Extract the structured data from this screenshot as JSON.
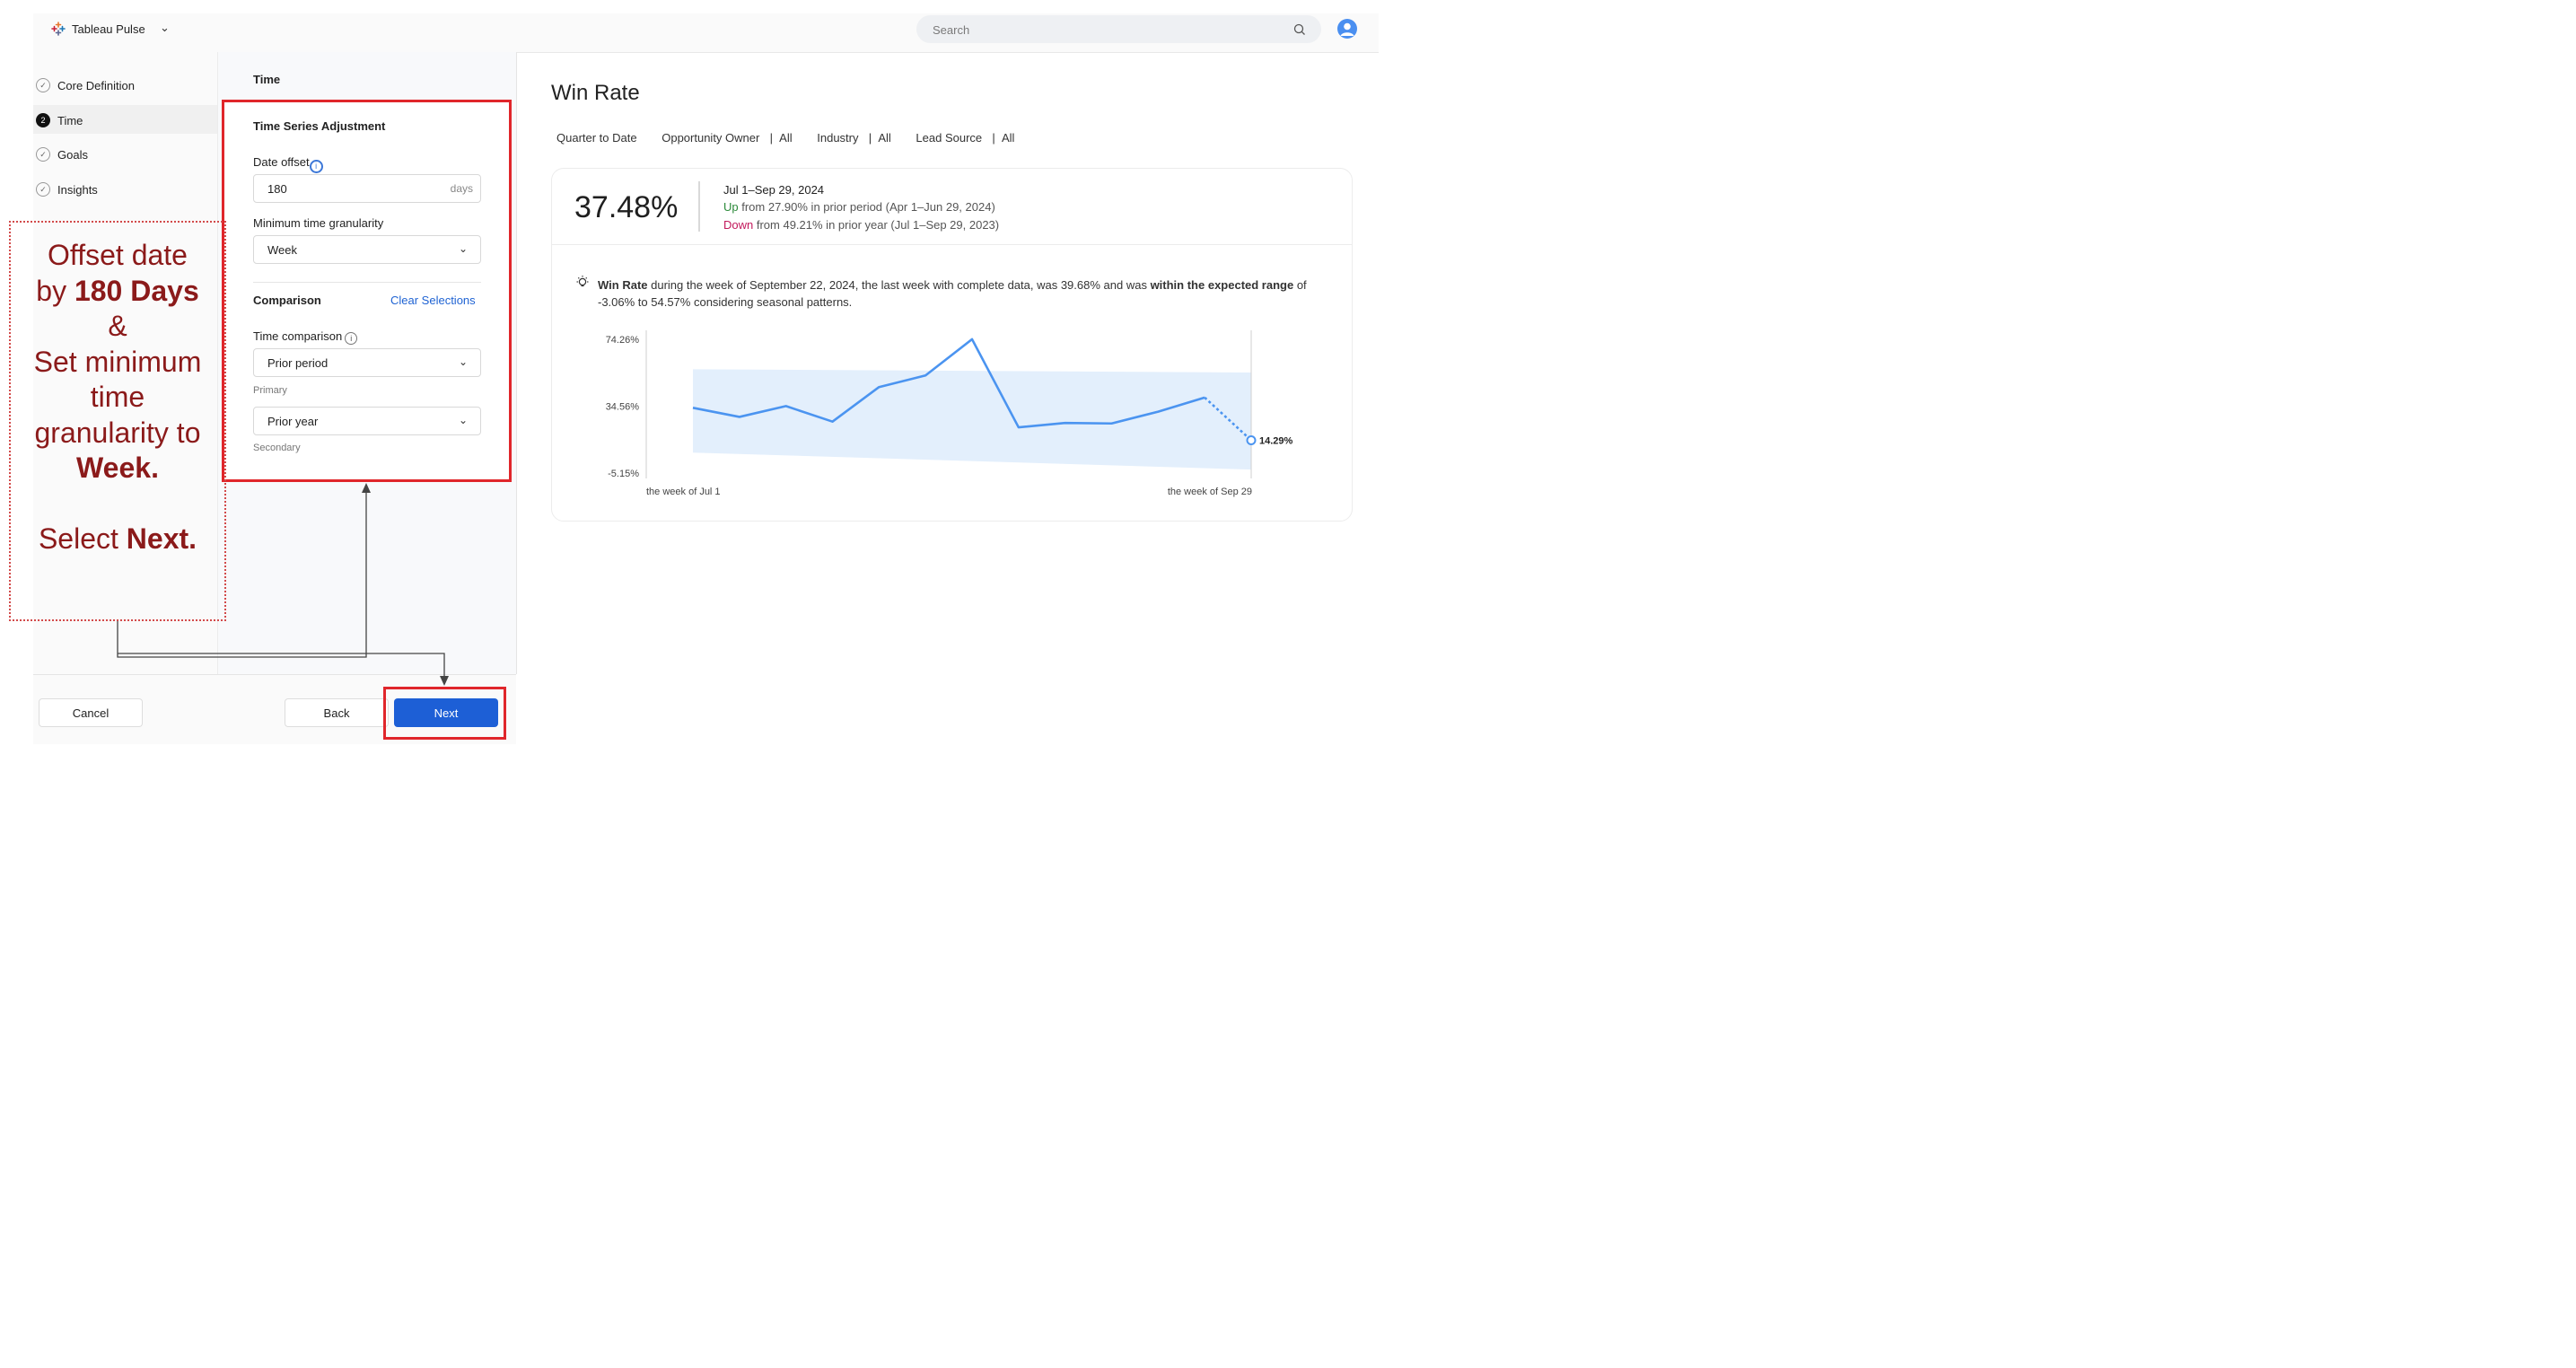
{
  "app": {
    "brand": "Tableau Pulse",
    "search_placeholder": "Search"
  },
  "steps": [
    {
      "label": "Core Definition",
      "state": "done"
    },
    {
      "label": "Time",
      "state": "active",
      "number": "2"
    },
    {
      "label": "Goals",
      "state": "done"
    },
    {
      "label": "Insights",
      "state": "done"
    }
  ],
  "panel": {
    "title": "Time",
    "section_title": "Time Series Adjustment",
    "date_offset_label": "Date offset",
    "date_offset_value": "180",
    "date_offset_unit": "days",
    "granularity_label": "Minimum time granularity",
    "granularity_value": "Week",
    "comparison_label": "Comparison",
    "clear_selections": "Clear Selections",
    "time_comparison_label": "Time comparison",
    "primary_value": "Prior period",
    "primary_caption": "Primary",
    "secondary_value": "Prior year",
    "secondary_caption": "Secondary"
  },
  "footer": {
    "cancel": "Cancel",
    "back": "Back",
    "next": "Next"
  },
  "annotation": {
    "line1": "Offset date",
    "line2a": "by ",
    "line2b": "180 Days",
    "line3": "&",
    "line4": "Set minimum",
    "line5": "time",
    "line6": "granularity to",
    "line7": "Week.",
    "line8a": "Select ",
    "line8b": "Next."
  },
  "metric": {
    "title": "Win Rate",
    "filters": [
      {
        "name": "Quarter to Date",
        "value": ""
      },
      {
        "name": "Opportunity Owner",
        "value": "All"
      },
      {
        "name": "Industry",
        "value": "All"
      },
      {
        "name": "Lead Source",
        "value": "All"
      }
    ],
    "value": "37.48%",
    "period": "Jul 1–Sep 29, 2024",
    "cmp1_dir": "Up",
    "cmp1_text": " from 27.90% in prior period (Apr 1–Jun 29, 2024)",
    "cmp2_dir": "Down",
    "cmp2_text": " from 49.21% in prior year (Jul 1–Sep 29, 2023)",
    "insight_bold1": "Win Rate",
    "insight_mid": " during the week of September 22, 2024, the last week with complete data, was 39.68% and was ",
    "insight_bold2": "within the expected range",
    "insight_end": " of -3.06% to 54.57% considering seasonal patterns."
  },
  "chart_data": {
    "type": "line",
    "y_ticks": [
      "74.26%",
      "34.56%",
      "-5.15%"
    ],
    "x_labels": [
      "the week of Jul 1",
      "the week of Sep 29"
    ],
    "ylim": [
      -5.15,
      74.26
    ],
    "series": [
      {
        "values": [
          33.6,
          28.2,
          34.6,
          25.4,
          45.9,
          52.8,
          74.3,
          22.0,
          24.6,
          24.3,
          31.3,
          39.7,
          14.29
        ]
      }
    ],
    "band_upper": [
      56.5,
      54.57
    ],
    "band_lower": [
      7.0,
      -3.06
    ],
    "end_label": "14.29%",
    "colors": {
      "line": "#4b94f0",
      "band": "#e3effc"
    }
  }
}
